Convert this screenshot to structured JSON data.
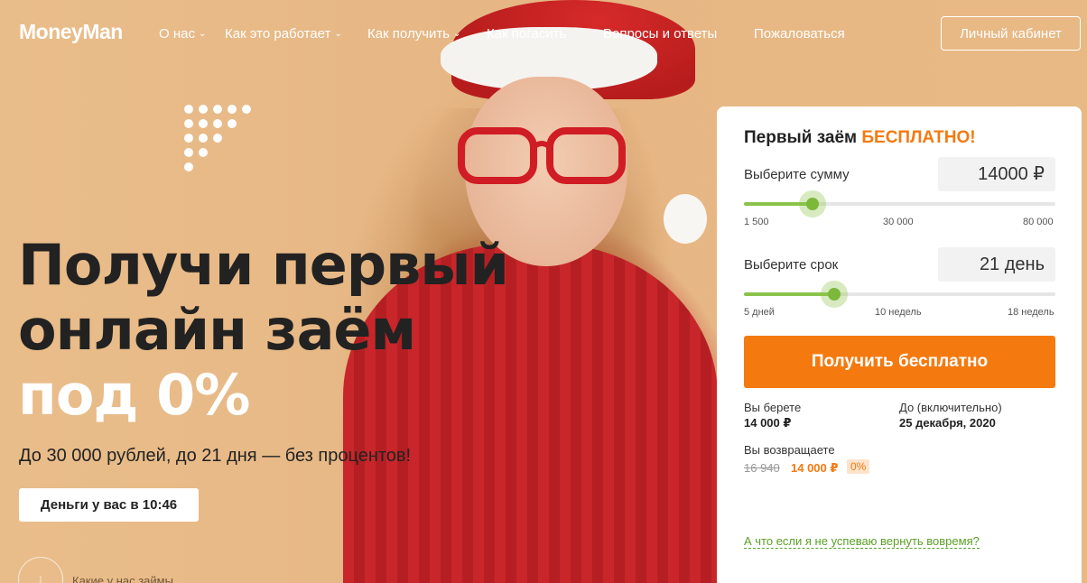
{
  "brand": {
    "logo": "MoneyMan"
  },
  "nav": {
    "items": [
      {
        "label": "О нас",
        "dropdown": true
      },
      {
        "label": "Как это работает",
        "dropdown": true
      },
      {
        "label": "Как получить",
        "dropdown": true
      },
      {
        "label": "Как погасить",
        "dropdown": false
      },
      {
        "label": "Вопросы и ответы",
        "dropdown": false
      },
      {
        "label": "Пожаловаться",
        "dropdown": false
      }
    ],
    "cabinet_label": "Личный кабинет"
  },
  "hero": {
    "headline_line1": "Получи первый",
    "headline_line2": "онлайн заём",
    "headline_line3": "под 0%",
    "subline": "До 30 000 рублей, до 21 дня — без процентов!",
    "timer_label": "Деньги у вас в 10:46",
    "how_link": "Какие у нас займы"
  },
  "calculator": {
    "title_prefix": "Первый заём",
    "title_accent": "БЕСПЛАТНО!",
    "amount": {
      "label": "Выберите сумму",
      "value": "14000 ₽",
      "ticks": [
        "1 500",
        "30 000",
        "80 000"
      ],
      "fraction": 0.22
    },
    "term": {
      "label": "Выберите срок",
      "value": "21 день",
      "ticks": [
        "5 дней",
        "10 недель",
        "18 недель"
      ],
      "fraction": 0.29
    },
    "cta_label": "Получить бесплатно",
    "summary": {
      "take_label": "Вы берете",
      "take_value": "14 000 ₽",
      "until_label": "До (включительно)",
      "until_value": "25 декабря, 2020",
      "return_label": "Вы возвращаете",
      "old_sum": "16 940",
      "new_sum": "14 000 ₽",
      "percent_badge": "0%"
    },
    "late_link": "А что если я не успеваю вернуть вовремя?"
  },
  "colors": {
    "accent_orange": "#f47a10",
    "slider_green": "#8bc34a",
    "background": "#e8b985"
  }
}
